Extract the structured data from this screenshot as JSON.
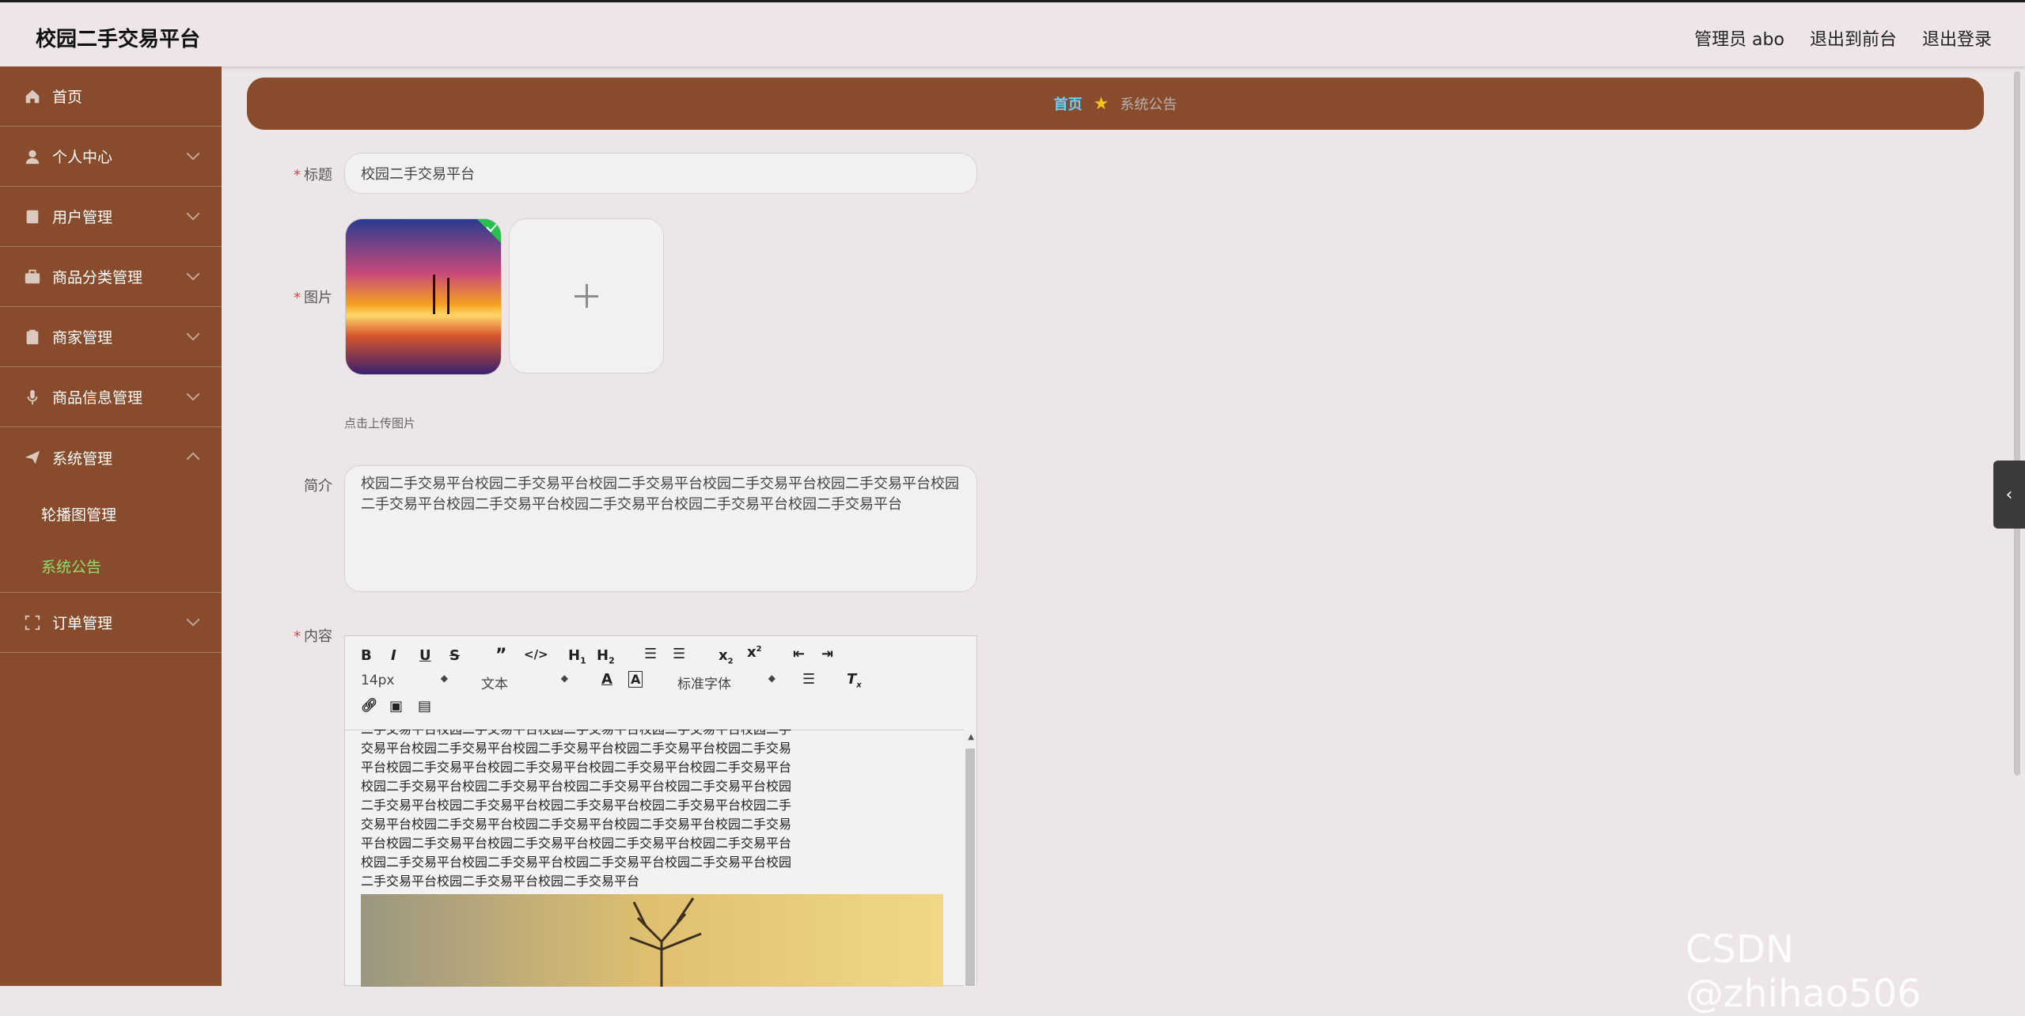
{
  "app": {
    "title": "校园二手交易平台"
  },
  "header": {
    "admin_label": "管理员 abo",
    "front_label": "退出到前台",
    "logout_label": "退出登录"
  },
  "sidebar": {
    "items": [
      {
        "label": "首页",
        "icon": "home-icon"
      },
      {
        "label": "个人中心",
        "icon": "user-icon"
      },
      {
        "label": "用户管理",
        "icon": "users-icon"
      },
      {
        "label": "商品分类管理",
        "icon": "category-icon"
      },
      {
        "label": "商家管理",
        "icon": "shop-icon"
      },
      {
        "label": "商品信息管理",
        "icon": "goods-icon"
      },
      {
        "label": "系统管理",
        "icon": "system-icon"
      },
      {
        "label": "订单管理",
        "icon": "order-icon"
      }
    ],
    "sub_items": [
      {
        "label": "轮播图管理"
      },
      {
        "label": "系统公告"
      }
    ]
  },
  "breadcrumb": {
    "home": "首页",
    "current": "系统公告"
  },
  "form": {
    "title_label": "标题",
    "title_value": "校园二手交易平台",
    "image_label": "图片",
    "upload_hint": "点击上传图片",
    "intro_label": "简介",
    "intro_value": "校园二手交易平台校园二手交易平台校园二手交易平台校园二手交易平台校园二手交易平台校园二手交易平台校园二手交易平台校园二手交易平台校园二手交易平台校园二手交易平台",
    "content_label": "内容"
  },
  "editor": {
    "font_size": "14px",
    "text_type": "文本",
    "font_family": "标准字体",
    "body_lines": [
      "二手交易平台校园二手交易平台校园二手交易平台校园二手交易平台校园二手",
      "交易平台校园二手交易平台校园二手交易平台校园二手交易平台校园二手交易",
      "平台校园二手交易平台校园二手交易平台校园二手交易平台校园二手交易平台",
      "校园二手交易平台校园二手交易平台校园二手交易平台校园二手交易平台校园",
      "二手交易平台校园二手交易平台校园二手交易平台校园二手交易平台校园二手",
      "交易平台校园二手交易平台校园二手交易平台校园二手交易平台校园二手交易",
      "平台校园二手交易平台校园二手交易平台校园二手交易平台校园二手交易平台",
      "校园二手交易平台校园二手交易平台校园二手交易平台校园二手交易平台校园",
      "二手交易平台校园二手交易平台校园二手交易平台"
    ]
  },
  "watermark": "CSDN @zhihao506",
  "colors": {
    "sidebar": "#884c2c",
    "accent_link": "#66d3ff",
    "active_sub": "#8ee06a",
    "required": "#e0443f"
  }
}
